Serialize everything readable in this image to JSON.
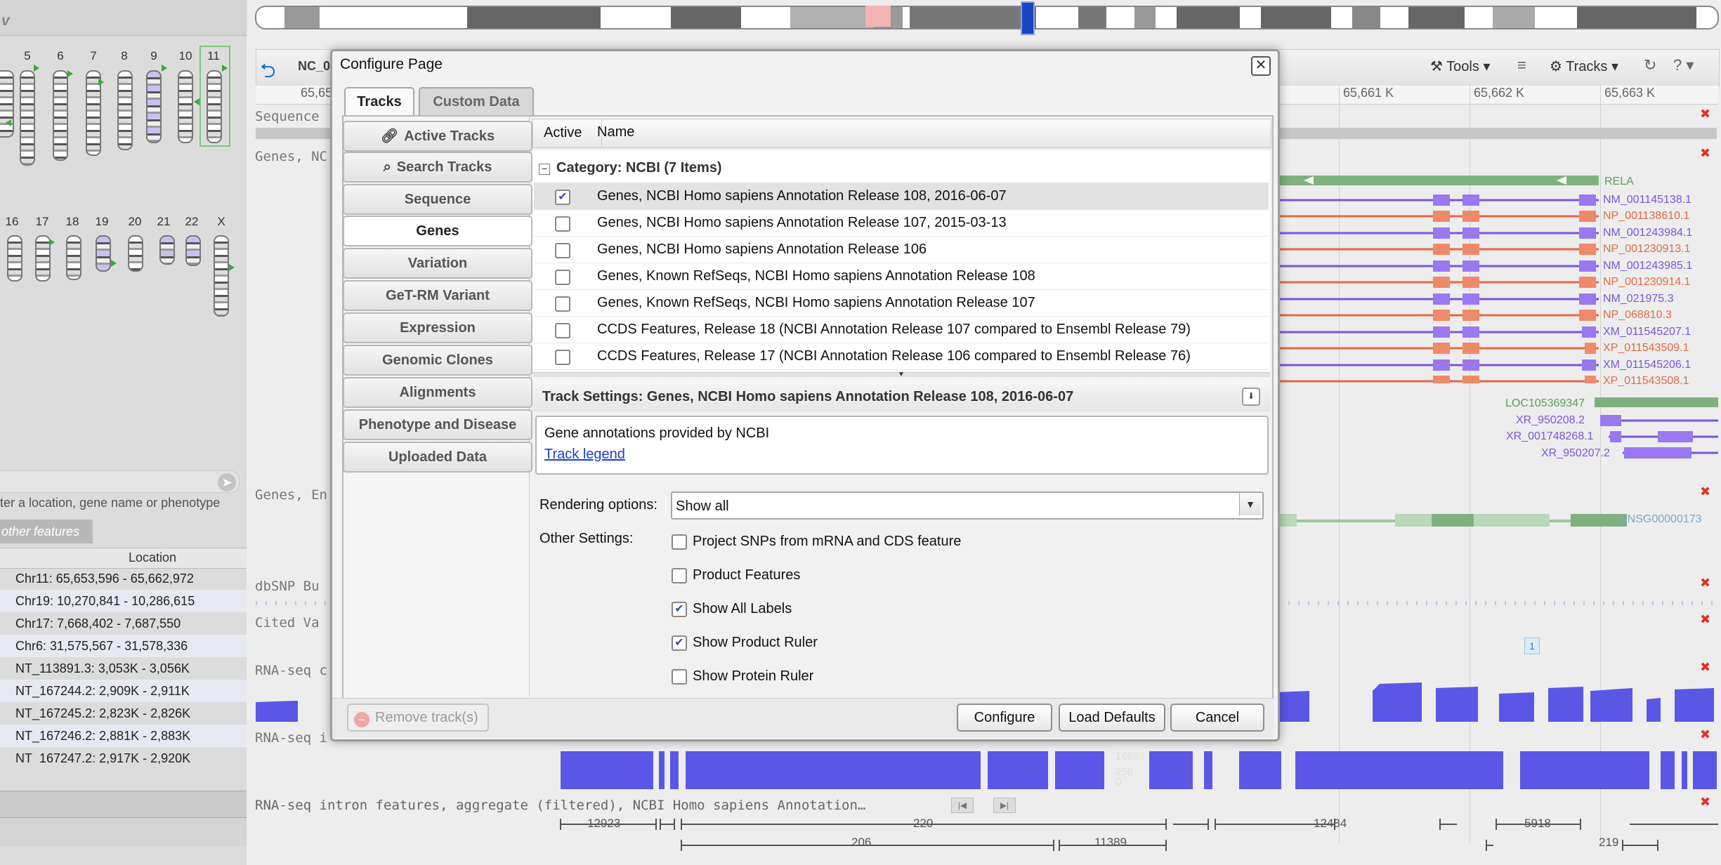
{
  "left_panel": {
    "top_letter": "v",
    "chromosomes_row1": [
      "5",
      "6",
      "7",
      "8",
      "9",
      "10",
      "11"
    ],
    "chromosomes_row2": [
      "16",
      "17",
      "18",
      "19",
      "20",
      "21",
      "22",
      "X"
    ],
    "search_placeholder": "ter a location, gene name or phenotype",
    "other_features_tab": "other features",
    "location_header": "Location",
    "locations": [
      "Chr11: 65,653,596 - 65,662,972",
      "Chr19: 10,270,841 - 10,286,615",
      "Chr17: 7,668,402 - 7,687,550",
      "Chr6: 31,575,567 - 31,578,336",
      "NT_113891.3: 3,053K - 3,056K",
      "NT_167244.2: 2,909K - 2,911K",
      "NT_167245.2: 2,823K - 2,826K",
      "NT_167246.2: 2,881K - 2,883K",
      "NT_167247.2: 2,917K - 2,920K"
    ]
  },
  "viewer": {
    "accession": "NC_0",
    "ruler_partial": "65,65",
    "ruler_ticks": [
      "65,661 K",
      "65,662 K",
      "65,663 K"
    ],
    "tools_label": "Tools",
    "tracks_label": "Tracks",
    "track_labels": {
      "sequence": "Sequence",
      "genes_ncbi": "Genes, NC",
      "genes_ens": "Genes, En",
      "dbsnp": "dbSNP Bu",
      "cited": "Cited Va",
      "rnaseq1": "RNA-seq c",
      "rnaseq2": "RNA-seq i",
      "intron": "RNA-seq intron features, aggregate (filtered), NCBI Homo sapiens Annotation…"
    },
    "gene_labels": {
      "rela": "RELA",
      "transcripts": [
        "NM_001145138.1",
        "NP_001138610.1",
        "NM_001243984.1",
        "NP_001230913.1",
        "NM_001243985.1",
        "NP_001230914.1",
        "NM_021975.3",
        "NP_068810.3",
        "XM_011545207.1",
        "XP_011543509.1",
        "XM_011545206.1",
        "XP_011543508.1"
      ],
      "loc": "LOC105369347",
      "xr_list": [
        "XR_950208.2",
        "XR_001748268.1",
        "XR_950207.2"
      ],
      "ens": "ENSG00000173"
    },
    "cited_badge": "1",
    "coverage_labels": [
      "16885",
      "256",
      "0"
    ],
    "intron_numbers": [
      "12923",
      "220",
      "12484",
      "5918",
      "206",
      "11389",
      "219"
    ]
  },
  "dialog": {
    "title": "Configure Page",
    "close_glyph": "✕",
    "tabs": [
      "Tracks",
      "Custom Data"
    ],
    "nav": [
      "Active Tracks",
      "Search Tracks",
      "Sequence",
      "Genes",
      "Variation",
      "GeT-RM Variant",
      "Expression",
      "Genomic Clones",
      "Alignments",
      "Phenotype and Disease",
      "Uploaded Data"
    ],
    "nav_active": "Genes",
    "grid": {
      "col_active": "Active",
      "col_name": "Name",
      "category_toggle": "−",
      "category": "Category: NCBI (7 Items)",
      "rows": [
        {
          "name": "Genes, NCBI Homo sapiens Annotation Release 108, 2016-06-07",
          "checked": true
        },
        {
          "name": "Genes, NCBI Homo sapiens Annotation Release 107, 2015-03-13",
          "checked": false
        },
        {
          "name": "Genes, NCBI Homo sapiens Annotation Release 106",
          "checked": false
        },
        {
          "name": "Genes, Known RefSeqs, NCBI Homo sapiens Annotation Release 108",
          "checked": false
        },
        {
          "name": "Genes, Known RefSeqs, NCBI Homo sapiens Annotation Release 107",
          "checked": false
        },
        {
          "name": "CCDS Features, Release 18 (NCBI Annotation Release 107 compared to Ensembl Release 79)",
          "checked": false
        },
        {
          "name": "CCDS Features, Release 17 (NCBI Annotation Release 106 compared to Ensembl Release 76)",
          "checked": false
        }
      ]
    },
    "settings": {
      "title": "Track Settings: Genes, NCBI Homo sapiens Annotation Release 108, 2016-06-07",
      "description": "Gene annotations provided by NCBI",
      "legend_link": "Track legend",
      "rendering_label": "Rendering options:",
      "rendering_value": "Show all",
      "other_label": "Other Settings:",
      "options": [
        {
          "label": "Project SNPs from mRNA and CDS feature",
          "checked": false
        },
        {
          "label": "Product Features",
          "checked": false
        },
        {
          "label": "Show All Labels",
          "checked": true
        },
        {
          "label": "Show Product Ruler",
          "checked": true
        },
        {
          "label": "Show Protein Ruler",
          "checked": false
        }
      ]
    },
    "footer": {
      "remove": "Remove track(s)",
      "remove_glyph": "−",
      "configure": "Configure",
      "load_defaults": "Load Defaults",
      "cancel": "Cancel"
    }
  }
}
